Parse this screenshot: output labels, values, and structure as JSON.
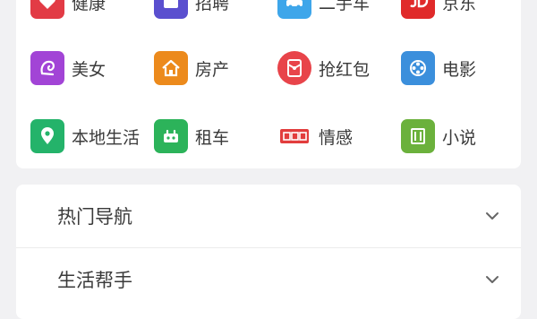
{
  "grid": {
    "items": [
      {
        "label": "健康",
        "icon": "health-icon",
        "color": "#e23b45"
      },
      {
        "label": "招聘",
        "icon": "briefcase-icon",
        "color": "#5a4fcf"
      },
      {
        "label": "二手车",
        "icon": "car-icon",
        "color": "#3ea6ea"
      },
      {
        "label": "京东",
        "icon": "jd-icon",
        "color": "#e02a2a"
      },
      {
        "label": "美女",
        "icon": "beauty-icon",
        "color": "#a244d6"
      },
      {
        "label": "房产",
        "icon": "house-icon",
        "color": "#ec8a1c"
      },
      {
        "label": "抢红包",
        "icon": "red-envelope-icon",
        "color": "#e8444a"
      },
      {
        "label": "电影",
        "icon": "film-reel-icon",
        "color": "#3b8fdc"
      },
      {
        "label": "本地生活",
        "icon": "location-pin-icon",
        "color": "#24b36a"
      },
      {
        "label": "租车",
        "icon": "rent-car-icon",
        "color": "#2cb35a"
      },
      {
        "label": "情感",
        "icon": "emotion-icon",
        "color": "#e23d3d"
      },
      {
        "label": "小说",
        "icon": "book-icon",
        "color": "#6bb13c"
      }
    ]
  },
  "sections": [
    {
      "label": "热门导航",
      "icon": "chevron-down-icon"
    },
    {
      "label": "生活帮手",
      "icon": "chevron-down-icon"
    }
  ]
}
